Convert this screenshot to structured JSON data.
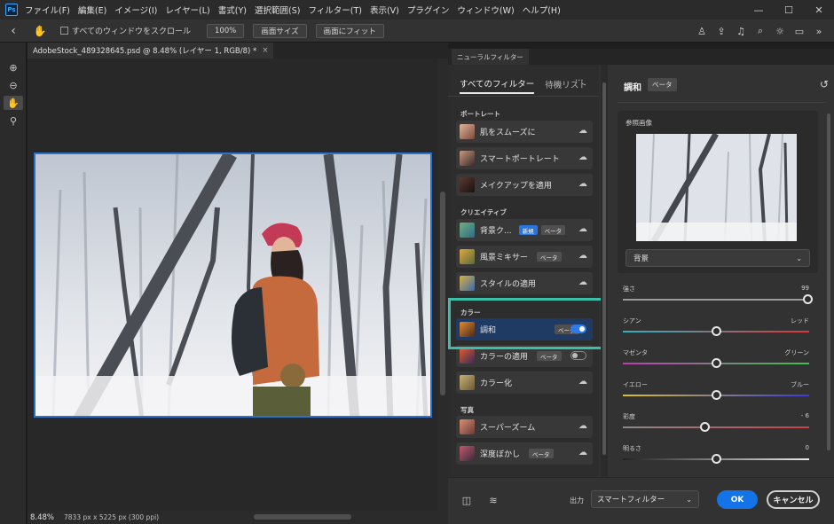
{
  "app": {
    "logo": "Ps",
    "menu": [
      "ファイル(F)",
      "編集(E)",
      "イメージ(I)",
      "レイヤー(L)",
      "書式(Y)",
      "選択範囲(S)",
      "フィルター(T)",
      "表示(V)",
      "プラグイン",
      "ウィンドウ(W)",
      "ヘルプ(H)"
    ],
    "window_controls": {
      "minimize": "—",
      "maximize": "☐",
      "close": "✕"
    }
  },
  "options": {
    "back": "‹",
    "scroll_all_label": "すべてのウィンドウをスクロール",
    "zoom_btn": "100%",
    "fit_screen_btn": "画面サイズ",
    "fill_screen_btn": "画面にフィット",
    "right_icons": [
      "person-icon",
      "share-icon",
      "bell-icon",
      "search-icon",
      "light-icon",
      "panel-icon",
      "expand-icon"
    ]
  },
  "document": {
    "tab_title": "AdobeStock_489328645.psd @ 8.48% (レイヤー 1, RGB/8) *",
    "close": "×",
    "zoom": "8.48%",
    "dims": "7833 px x 5225 px (300 ppi)"
  },
  "neural": {
    "panel_tab": "ニューラルフィルター",
    "tabs": {
      "all": "すべてのフィルター",
      "wait": "待機リスト",
      "more": "···"
    },
    "categories": {
      "portrait": "ポートレート",
      "creative": "クリエイティブ",
      "color": "カラー",
      "photo": "写真"
    },
    "filters": {
      "smooth_skin": "肌をスムーズに",
      "smart_portrait": "スマートポートレート",
      "makeup": "メイクアップを適用",
      "background": "背景ク...",
      "landscape": "風景ミキサー",
      "style": "スタイルの適用",
      "harmonize": "調和",
      "color_transfer": "カラーの適用",
      "colorize": "カラー化",
      "superzoom": "スーパーズーム",
      "depth_blur": "深度ぼかし"
    },
    "badge_new": "新規",
    "badge_beta": "ベータ",
    "detail": {
      "title": "調和",
      "beta": "ベータ",
      "ref_label": "参照画像",
      "ref_layer": "背景",
      "sliders": [
        {
          "label": "強さ",
          "right": "99",
          "value": 0.99
        },
        {
          "label": "シアン",
          "right": "レッド",
          "value": 0.5
        },
        {
          "label": "マゼンタ",
          "right": "グリーン",
          "value": 0.5
        },
        {
          "label": "イエロー",
          "right": "ブルー",
          "value": 0.5
        },
        {
          "label": "彩度",
          "right": "- 6",
          "value": 0.44
        },
        {
          "label": "明るさ",
          "right": "0",
          "value": 0.5
        }
      ]
    },
    "footer": {
      "output_label": "出力",
      "output_value": "スマートフィルター",
      "ok": "OK",
      "cancel": "キャンセル"
    }
  },
  "colors": {
    "accent_blue": "#1473e6",
    "highlight_teal": "#3cbfa8",
    "selected_row": "#1f3b63"
  }
}
